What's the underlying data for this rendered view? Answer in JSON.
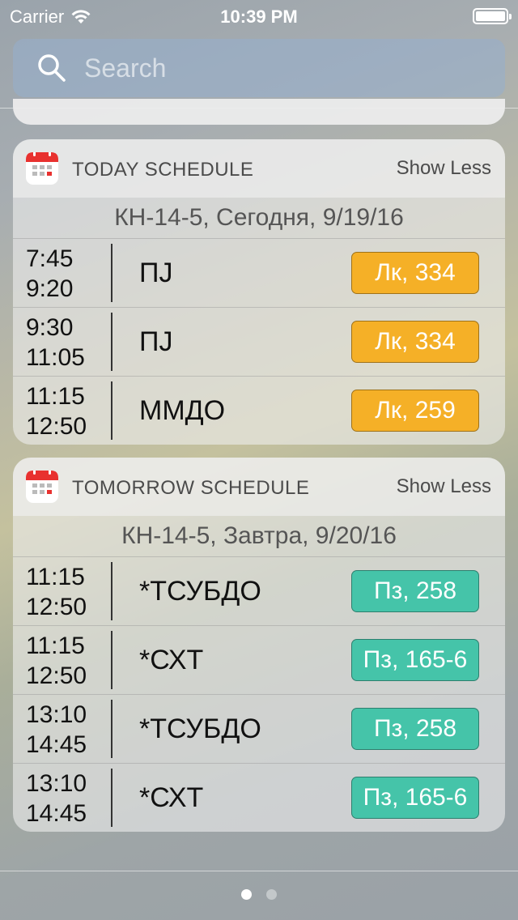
{
  "status": {
    "carrier": "Carrier",
    "time": "10:39 PM",
    "battery_level": 1.0
  },
  "search": {
    "placeholder": "Search"
  },
  "widgets": [
    {
      "title": "TODAY SCHEDULE",
      "action": "Show Less",
      "date_line": "КН-14-5, Сегодня, 9/19/16",
      "rows": [
        {
          "start": "7:45",
          "end": "9:20",
          "subject": "ПJ",
          "tag": "Лк, 334"
        },
        {
          "start": "9:30",
          "end": "11:05",
          "subject": "ПJ",
          "tag": "Лк, 334"
        },
        {
          "start": "11:15",
          "end": "12:50",
          "subject": "ММДО",
          "tag": "Лк, 259"
        }
      ]
    },
    {
      "title": "TOMORROW SCHEDULE",
      "action": "Show Less",
      "date_line": "КН-14-5, Завтра, 9/20/16",
      "rows": [
        {
          "start": "11:15",
          "end": "12:50",
          "subject": "*ТСУБДО",
          "tag": "Пз, 258"
        },
        {
          "start": "11:15",
          "end": "12:50",
          "subject": "*СХТ",
          "tag": "Пз, 165-6"
        },
        {
          "start": "13:10",
          "end": "14:45",
          "subject": "*ТСУБДО",
          "tag": "Пз, 258"
        },
        {
          "start": "13:10",
          "end": "14:45",
          "subject": "*СХТ",
          "tag": "Пз, 165-6"
        }
      ]
    }
  ],
  "colors": {
    "lecture_tag": "#f5b027",
    "practice_tag": "#45c4a9"
  },
  "page_indicator": {
    "pages": 2,
    "current": 1
  }
}
